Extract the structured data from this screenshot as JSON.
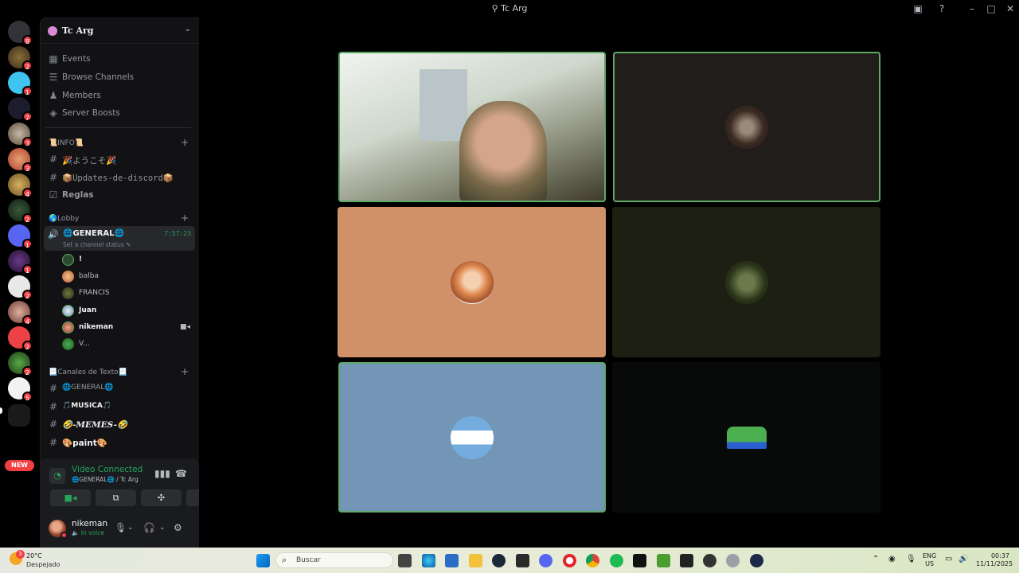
{
  "window": {
    "title": "Tc Arg",
    "logo_icon": "discord-fork-icon"
  },
  "rail": {
    "badges": [
      "8",
      "2",
      "1",
      "7",
      "3",
      "3",
      "4",
      "2",
      "1",
      "1",
      "2",
      "4",
      "2",
      "2",
      "5"
    ],
    "new_label": "NEW"
  },
  "server": {
    "name": "Tc Arg"
  },
  "menu": {
    "events": "Events",
    "browse": "Browse Channels",
    "members": "Members",
    "boosts": "Server Boosts"
  },
  "categories": {
    "info": "📜INFO📜",
    "lobby": "🌎Lobby",
    "text": "📃Canales de Texto📃"
  },
  "info_channels": {
    "welcome": "🎉ようこそ🎉",
    "updates": "📦Updates-de-discord📦",
    "rules": "Reglas"
  },
  "voice": {
    "name": "🌐GENERAL🌐",
    "timer": "7:57:23",
    "status": "Set a channel status"
  },
  "voice_users": [
    "!",
    "balba",
    "FRANCIS",
    "Juan",
    "nikeman",
    "V..."
  ],
  "text_channels": {
    "general": "🌐GENERAL🌐",
    "musica": "🎵MUSICA🎵",
    "memes": "🤣-MEMES-🤣",
    "paint": "🎨paint🎨"
  },
  "connection": {
    "status": "Video Connected",
    "location": "🌐GENERAL🌐 / Tc Arg"
  },
  "user": {
    "name": "nikeman",
    "status": "In voice"
  },
  "taskbar": {
    "temp": "20°C",
    "weather": "Despejado",
    "weather_badge": "3",
    "search": "Buscar",
    "lang1": "ENG",
    "lang2": "US",
    "time": "00:37",
    "date": "11/11/2025"
  },
  "colors": {
    "accent": "#23a55a",
    "danger": "#f23f42",
    "tile_border": "#5fa865",
    "tile_orange": "#d09068",
    "tile_blue": "#7396b6"
  }
}
